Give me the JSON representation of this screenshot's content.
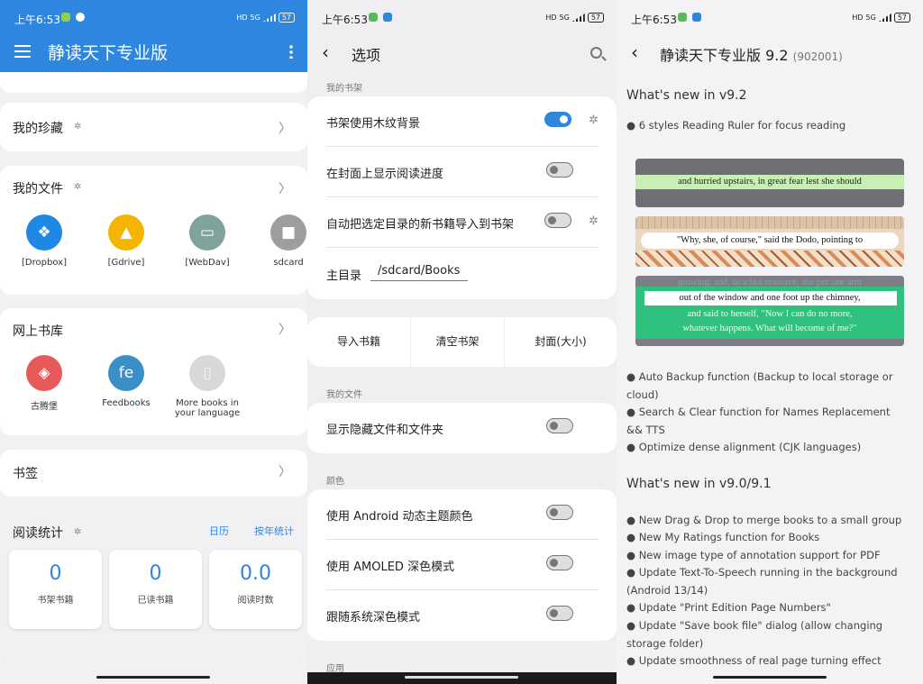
{
  "status": {
    "time": "上午6:53",
    "battery": "57",
    "net": "5G",
    "hd": "HD"
  },
  "panel1": {
    "title": "静读天下专业版",
    "favorites": "我的珍藏",
    "my_files": "我的文件",
    "file_sources": [
      "[Dropbox]",
      "[Gdrive]",
      "[WebDav]",
      "sdcard"
    ],
    "online_library": "网上书库",
    "online_sources": [
      "古腾堡",
      "Feedbooks",
      "More books in your language"
    ],
    "bookmarks": "书签",
    "reading_stats": "阅读统计",
    "stats_links": [
      "日历",
      "按年统计"
    ],
    "stats": [
      {
        "value": "0",
        "label": "书架书籍"
      },
      {
        "value": "0",
        "label": "已读书籍"
      },
      {
        "value": "0.0",
        "label": "阅读时数"
      }
    ],
    "colors": {
      "accent": "#2e86de"
    }
  },
  "panel2": {
    "title": "选项",
    "sec_shelf": "我的书架",
    "shelf_rows": [
      {
        "label": "书架使用木纹背景",
        "on": true
      },
      {
        "label": "在封面上显示阅读进度",
        "on": false
      },
      {
        "label": "自动把选定目录的新书籍导入到书架",
        "on": false
      }
    ],
    "main_dir_label": "主目录",
    "main_dir_value": "/sdcard/Books",
    "buttons": [
      "导入书籍",
      "清空书架",
      "封面(大小)"
    ],
    "sec_files": "我的文件",
    "files_row": "显示隐藏文件和文件夹",
    "sec_color": "颜色",
    "color_rows": [
      "使用 Android 动态主题颜色",
      "使用 AMOLED 深色模式",
      "跟随系统深色模式"
    ],
    "sec_app": "应用"
  },
  "panel3": {
    "title": "静读天下专业版 9.2",
    "version": "(902001)",
    "h_v92": "What's new in v9.2",
    "v92_first": "6 styles Reading Ruler for focus reading",
    "ruler_lines": [
      "and hurried upstairs, in great fear lest she should",
      "\"Why, she, of course,\" said the Dodo, pointing to",
      "growing, and, as a last resource, she put one arm",
      "out of the window and one foot up the chimney,",
      "and said to herself, \"Now I can do no more,",
      "whatever happens. What will become of me?\""
    ],
    "v92_items": [
      "Auto Backup function (Backup to local storage or cloud)",
      "Search & Clear function for Names Replacement && TTS",
      "Optimize dense alignment (CJK languages)"
    ],
    "h_v90": "What's new in v9.0/9.1",
    "v90_items": [
      "New Drag & Drop to merge books to a small group",
      "New My Ratings function for Books",
      "New image type of annotation support for PDF",
      "Update Text-To-Speech running in the background (Android 13/14)",
      "Update \"Print Edition Page Numbers\"",
      "Update \"Save book file\" dialog (allow changing storage folder)",
      "Update smoothness of real page turning effect"
    ]
  }
}
